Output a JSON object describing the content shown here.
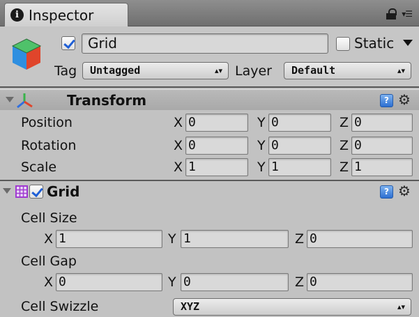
{
  "tab": {
    "title": "Inspector"
  },
  "object": {
    "name": "Grid",
    "enabled": true,
    "static_label": "Static",
    "static_checked": false,
    "tag_label": "Tag",
    "tag_value": "Untagged",
    "layer_label": "Layer",
    "layer_value": "Default"
  },
  "transform": {
    "title": "Transform",
    "rows": [
      {
        "label": "Position",
        "x": "0",
        "y": "0",
        "z": "0"
      },
      {
        "label": "Rotation",
        "x": "0",
        "y": "0",
        "z": "0"
      },
      {
        "label": "Scale",
        "x": "1",
        "y": "1",
        "z": "1"
      }
    ],
    "axis": {
      "x": "X",
      "y": "Y",
      "z": "Z"
    }
  },
  "grid": {
    "title": "Grid",
    "enabled": true,
    "cell_size": {
      "label": "Cell Size",
      "x": "1",
      "y": "1",
      "z": "0"
    },
    "cell_gap": {
      "label": "Cell Gap",
      "x": "0",
      "y": "0",
      "z": "0"
    },
    "cell_swizzle": {
      "label": "Cell Swizzle",
      "value": "XYZ"
    }
  },
  "icons": {
    "info": "info-icon",
    "lock": "lock-icon",
    "menu": "context-menu-icon",
    "cube": "gameobject-cube-icon",
    "transform": "transform-axes-icon",
    "grid": "grid-icon",
    "help": "help-icon",
    "gear": "gear-icon"
  },
  "colors": {
    "panel_bg": "#c2c2c2",
    "header_bg": "#b0b0b0",
    "check_color": "#1f5fd6",
    "help_blue": "#2d6fd1"
  }
}
